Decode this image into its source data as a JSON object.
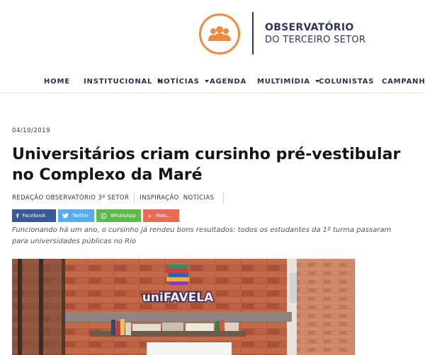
{
  "logo": {
    "line1": "OBSERVATÓRIO",
    "line2": "DO TERCEIRO SETOR",
    "accent": "#f08a3c",
    "brand": "#2e3468",
    "icon": "people-icon"
  },
  "nav": {
    "items": [
      {
        "label": "HOME",
        "dropdown": false
      },
      {
        "label": "INSTITUCIONAL",
        "dropdown": true
      },
      {
        "label": "NOTÍCIAS",
        "dropdown": true
      },
      {
        "label": "AGENDA",
        "dropdown": false
      },
      {
        "label": "MULTIMÍDIA",
        "dropdown": true
      },
      {
        "label": "COLUNISTAS",
        "dropdown": false
      },
      {
        "label": "CAMPANHAS",
        "dropdown": false
      }
    ]
  },
  "article": {
    "date": "04/10/2019",
    "title": "Universitários criam cursinho pré-vestibular no Complexo da Maré",
    "author": "REDAÇÃO OBSERVATÓRIO 3º SETOR",
    "tags": [
      "INSPIRAÇÃO",
      "NOTÍCIAS"
    ],
    "lede": "Funcionando há um ano, o cursinho já rendeu bons resultados: todos os estudantes da 1º turma passaram para universidades públicas no Rio"
  },
  "share": {
    "facebook": "Facebook",
    "twitter": "Twitter",
    "whatsapp": "WhatsApp",
    "more": "Mais...",
    "colors": {
      "facebook": "#3b5998",
      "twitter": "#55acee",
      "whatsapp": "#5dba4b",
      "more": "#e96a55"
    }
  },
  "photo": {
    "sign_text": "uniFAVELA",
    "icons": [
      "books-icon"
    ]
  }
}
